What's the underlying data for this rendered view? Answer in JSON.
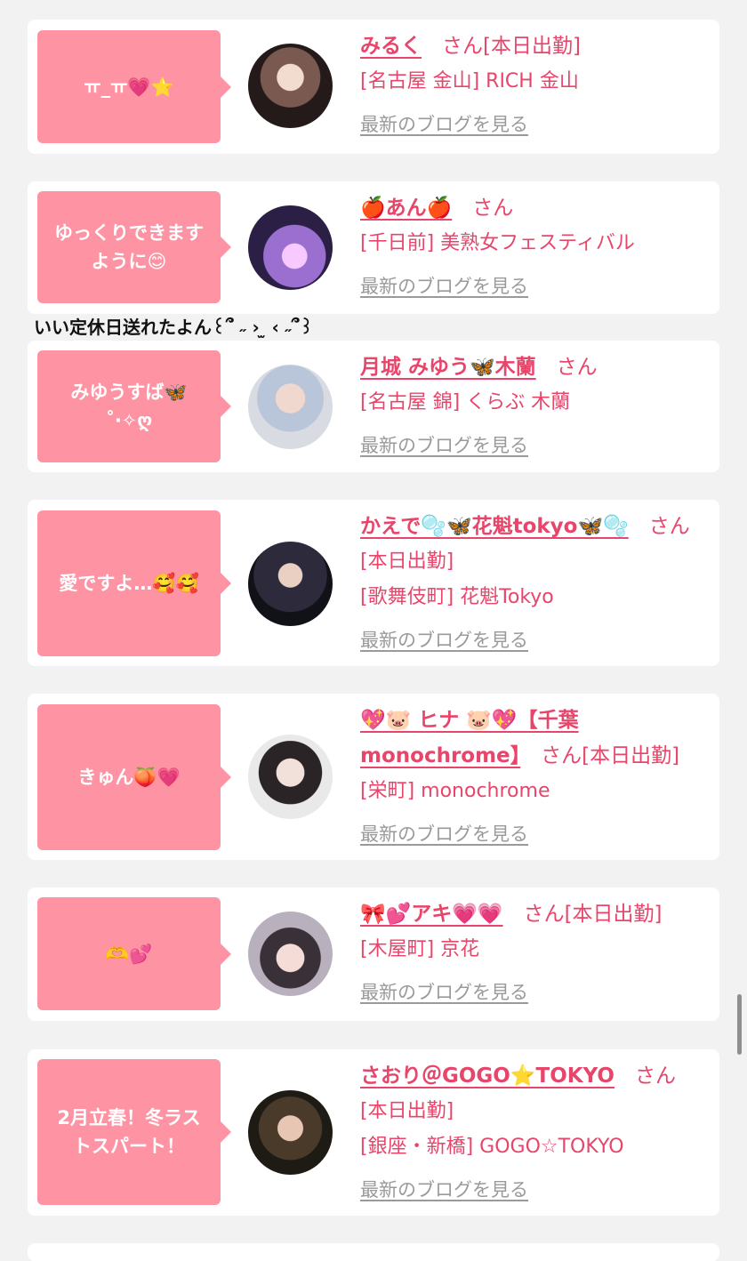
{
  "between_text": "いい定休日送れたよん꒰՞ ˶ › ̫ ‹ ˶՞꒱",
  "cards": [
    {
      "comment": "ㅠ_ㅠ💗⭐️",
      "name": "みるく",
      "san": "さん",
      "status": "[本日出勤]",
      "shop": "[名古屋 金山] RICH 金山",
      "blog_link": "最新のブログを見る"
    },
    {
      "comment": "ゆっくりできます\nように😊",
      "name": "🍎あん🍎",
      "san": "さん",
      "status": "",
      "shop": "[千日前] 美熟女フェスティバル",
      "blog_link": "最新のブログを見る"
    },
    {
      "comment": "みゆうすば🦋\n˚‧✧ღ",
      "name": "月城 みゆう🦋木蘭",
      "san": "さん",
      "status": "",
      "shop": "[名古屋 錦] くらぶ 木蘭",
      "blog_link": "最新のブログを見る"
    },
    {
      "comment": "愛ですよ…🥰🥰",
      "name": "かえで🫧🦋花魁tokyo🦋🫧",
      "san": "さん",
      "status": "[本日出勤]",
      "shop": "[歌舞伎町] 花魁Tokyo",
      "blog_link": "最新のブログを見る"
    },
    {
      "comment": "きゅん🍑💗",
      "name": "💖🐷 ヒナ 🐷💖【千葉 monochrome】",
      "san": "さん",
      "status": "[本日出勤]",
      "shop": "[栄町] monochrome",
      "blog_link": "最新のブログを見る"
    },
    {
      "comment": "🫶💕",
      "name": "🎀💕アキ💗💗",
      "san": "さん",
      "status": "[本日出勤]",
      "shop": "[木屋町] 京花",
      "blog_link": "最新のブログを見る"
    },
    {
      "comment": "2月立春！冬ラス\nトスパート！",
      "name": "さおり＠GOGO⭐️TOKYO",
      "san": "さん",
      "status": "[本日出勤]",
      "shop": "[銀座・新橋] GOGO☆TOKYO",
      "blog_link": "最新のブログを見る"
    }
  ]
}
